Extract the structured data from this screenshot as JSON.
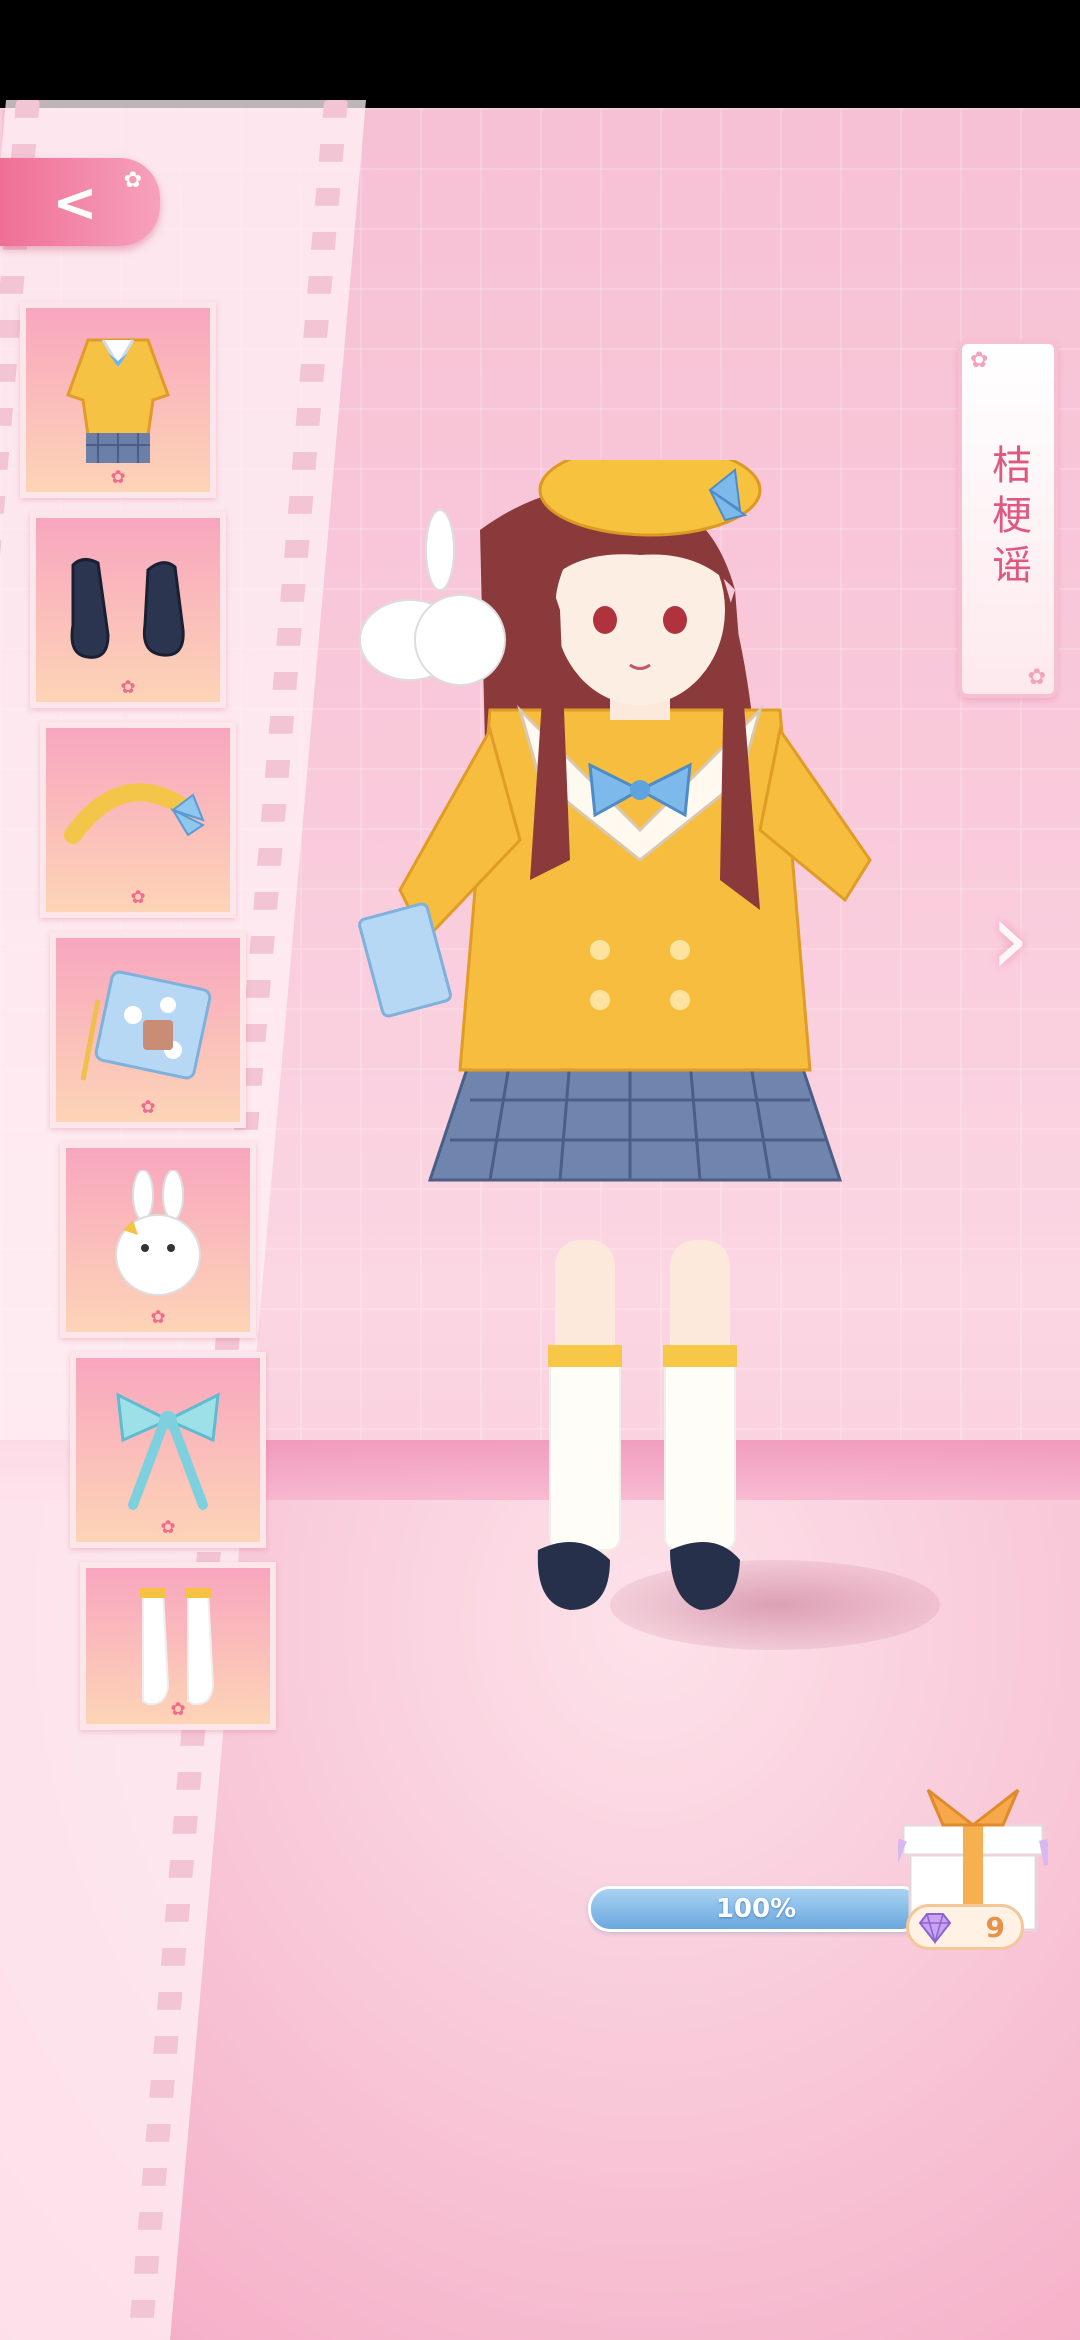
{
  "status_bar": {},
  "back_button": {
    "icon": "chevron-left-icon"
  },
  "character_name": "桔梗谣",
  "next_arrow_icon": "chevron-right-icon",
  "wardrobe_items": [
    {
      "name": "yellow-sailor-coat-outfit",
      "icon": "outfit-icon",
      "rarity": "✿"
    },
    {
      "name": "navy-loafers",
      "icon": "shoes-icon",
      "rarity": "✿"
    },
    {
      "name": "yellow-headband",
      "icon": "headband-icon",
      "rarity": "✿"
    },
    {
      "name": "floral-clutch",
      "icon": "bag-icon",
      "rarity": "✿"
    },
    {
      "name": "bunny-plush",
      "icon": "bunny-icon",
      "rarity": "✿"
    },
    {
      "name": "blue-ribbon-bow",
      "icon": "bow-icon",
      "rarity": "✿"
    },
    {
      "name": "white-knee-socks",
      "icon": "socks-icon",
      "rarity": "✿"
    }
  ],
  "progress": {
    "value": 1.0,
    "label": "100%"
  },
  "reward": {
    "icon": "gift-icon",
    "gem_icon": "gem-icon",
    "count": "9"
  },
  "colors": {
    "accent": "#ef6f95",
    "progress": "#6aa8de",
    "gem_text": "#e79248"
  }
}
